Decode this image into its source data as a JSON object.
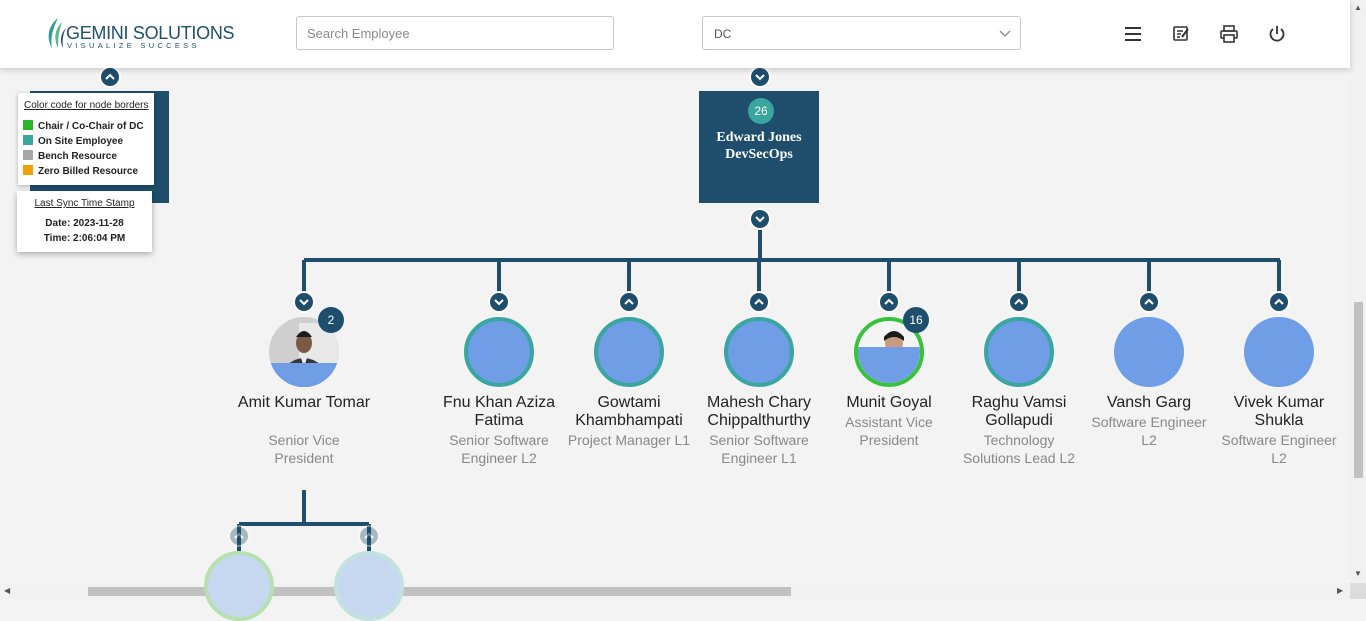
{
  "header": {
    "brand": "GEMINI SOLUTIONS",
    "tagline": "VISUALIZE SUCCESS",
    "search_placeholder": "Search Employee",
    "dc_selected": "DC",
    "icons": [
      "menu-icon",
      "edit-note-icon",
      "print-icon",
      "power-icon"
    ]
  },
  "legend": {
    "title": "Color code for node borders",
    "items": [
      {
        "label": "Chair / Co-Chair of DC",
        "color": "#2ab52a"
      },
      {
        "label": "On Site Employee",
        "color": "#3aa6a0"
      },
      {
        "label": "Bench Resource",
        "color": "#a6a6a6"
      },
      {
        "label": "Zero Billed Resource",
        "color": "#f0a000"
      }
    ]
  },
  "sync": {
    "title": "Last Sync Time Stamp",
    "date": "Date: 2023-11-28",
    "time": "Time: 2:06:04 PM"
  },
  "root": {
    "count": "26",
    "name_line1": "Edward Jones",
    "name_line2": "DevSecOps"
  },
  "employees": [
    {
      "name": "Amit Kumar Tomar",
      "title": "Senior Vice President",
      "count": "2",
      "border": "none",
      "photo": true
    },
    {
      "name": "Fnu Khan Aziza Fatima",
      "title": "Senior Software Engineer L2",
      "border": "teal"
    },
    {
      "name": "Gowtami Khambhampati",
      "title": "Project Manager L1",
      "border": "teal"
    },
    {
      "name": "Mahesh Chary Chippalthurthy",
      "title": "Senior Software Engineer L1",
      "border": "teal"
    },
    {
      "name": "Munit Goyal",
      "title": "Assistant Vice President",
      "count": "16",
      "border": "green",
      "photo": true
    },
    {
      "name": "Raghu Vamsi Gollapudi",
      "title": "Technology Solutions Lead L2",
      "border": "teal"
    },
    {
      "name": "Vansh Garg",
      "title": "Software Engineer L2",
      "border": "none"
    },
    {
      "name": "Vivek Kumar Shukla",
      "title": "Software Engineer L2",
      "border": "none"
    }
  ],
  "colors": {
    "node_dark": "#1f4e6d",
    "avatar_fill": "#6f9de6",
    "badge_teal": "#3aa6a0"
  }
}
